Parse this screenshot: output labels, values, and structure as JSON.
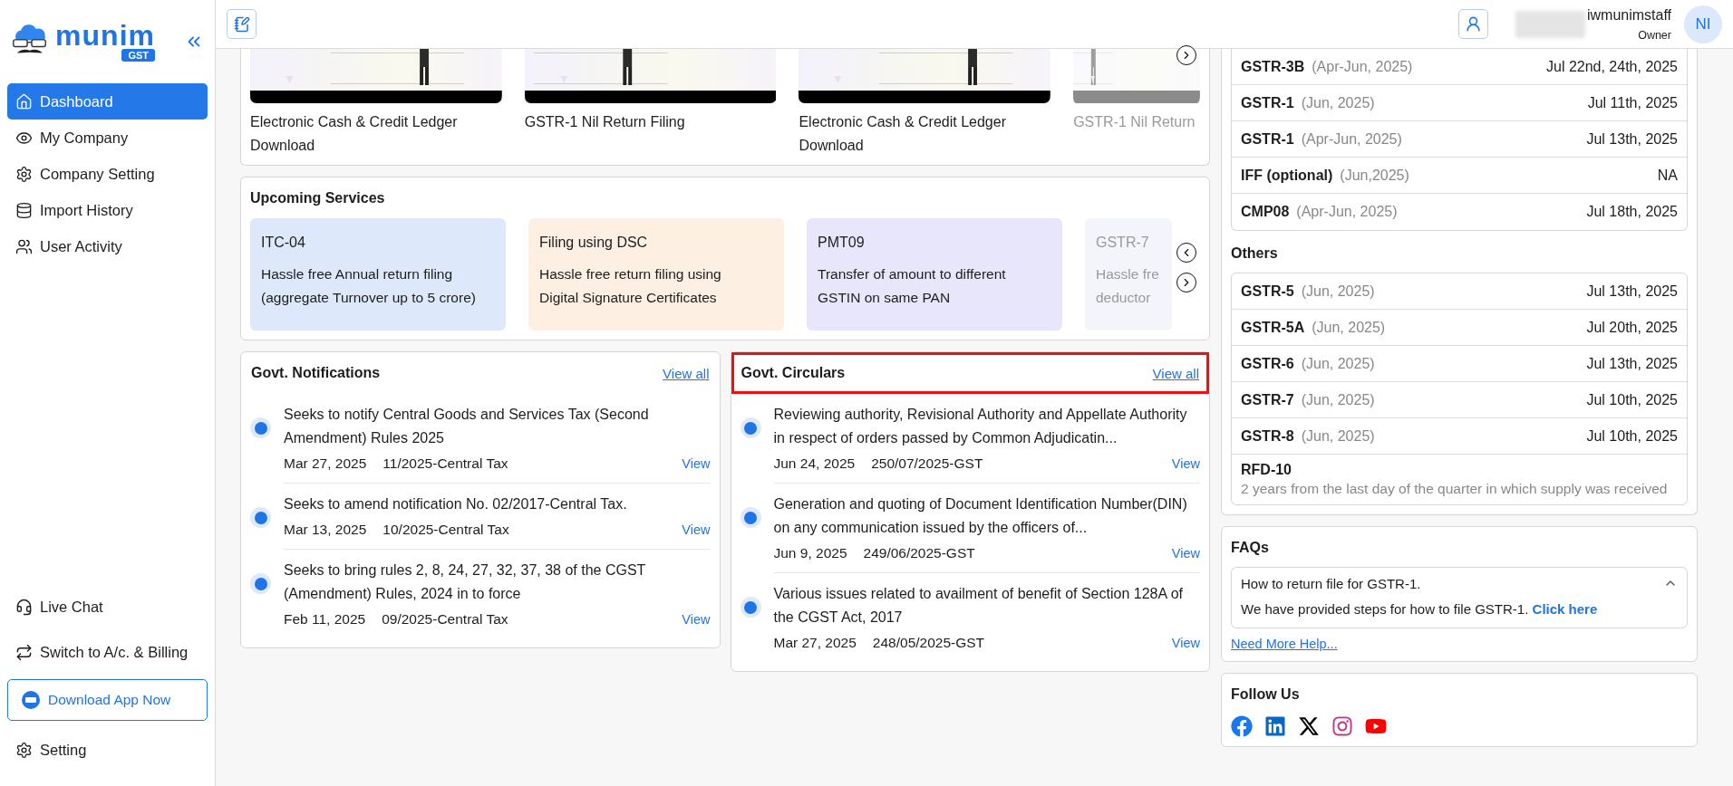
{
  "sidebar": {
    "logo": {
      "name": "munim",
      "badge": "GST"
    },
    "items": [
      {
        "label": "Dashboard",
        "selected": true
      },
      {
        "label": "My Company",
        "selected": false
      },
      {
        "label": "Company Setting",
        "selected": false
      },
      {
        "label": "Import History",
        "selected": false
      },
      {
        "label": "User Activity",
        "selected": false
      }
    ],
    "bottom_items": [
      {
        "label": "Live Chat"
      },
      {
        "label": "Switch to A/c. & Billing"
      }
    ],
    "download_button": "Download App Now",
    "setting": "Setting"
  },
  "header": {
    "user_name": "iwmunimstaff",
    "role": "Owner",
    "avatar_initials": "NI"
  },
  "videos": [
    {
      "title": "Electronic Cash & Credit Ledger Download",
      "faded": false
    },
    {
      "title": "GSTR-1 Nil Return Filing",
      "faded": false
    },
    {
      "title": "Electronic Cash & Credit Ledger Download",
      "faded": false
    },
    {
      "title": "GSTR-1 Nil Return",
      "faded": true
    }
  ],
  "upcoming_services": {
    "title": "Upcoming Services",
    "items": [
      {
        "title": "ITC-04",
        "description": "Hassle free Annual return filing\n(aggregate Turnover up to 5 crore)",
        "color": "#dde9fb",
        "faded": false
      },
      {
        "title": "Filing using DSC",
        "description": "Hassle free return filing using\nDigital Signature Certificates",
        "color": "#fdefe2",
        "faded": false
      },
      {
        "title": "PMT09",
        "description": "Transfer of amount to different\nGSTIN on same PAN",
        "color": "#e8e6fb",
        "faded": false
      },
      {
        "title": "GSTR-7",
        "description": "Hassle fre\ndeductor",
        "color": "#f4f4fb",
        "faded": true
      }
    ]
  },
  "notifications": {
    "title": "Govt. Notifications",
    "view_all": "View all",
    "highlighted": false,
    "items": [
      {
        "text": "Seeks to notify Central Goods and Services Tax (Second Amendment) Rules 2025",
        "date": "Mar 27, 2025",
        "number": "11/2025-Central Tax",
        "action": "View"
      },
      {
        "text": "Seeks to amend notification No. 02/2017-Central Tax.",
        "date": "Mar 13, 2025",
        "number": "10/2025-Central Tax",
        "action": "View"
      },
      {
        "text": "Seeks to bring rules 2, 8, 24, 27, 32, 37, 38 of the CGST (Amendment) Rules, 2024 in to force",
        "date": "Feb 11, 2025",
        "number": "09/2025-Central Tax",
        "action": "View"
      }
    ]
  },
  "circulars": {
    "title": "Govt. Circulars",
    "view_all": "View all",
    "highlighted": true,
    "items": [
      {
        "text": "Reviewing authority, Revisional Authority and Appellate Authority in respect of orders passed by Common Adjudicatin...",
        "date": "Jun 24, 2025",
        "number": "250/07/2025-GST",
        "action": "View"
      },
      {
        "text": "Generation and quoting of Document Identification Number(DIN) on any communication issued by the officers of...",
        "date": "Jun 9, 2025",
        "number": "249/06/2025-GST",
        "action": "View"
      },
      {
        "text": "Various issues related to availment of benefit of Section 128A of the CGST Act, 2017",
        "date": "Mar 27, 2025",
        "number": "248/05/2025-GST",
        "action": "View"
      }
    ]
  },
  "due_dates": {
    "rows": [
      {
        "form": "GSTR-3B",
        "period": "(Apr-Jun, 2025)",
        "date": "Jul 22nd, 24th, 2025"
      },
      {
        "form": "GSTR-1",
        "period": "(Jun, 2025)",
        "date": "Jul 11th, 2025"
      },
      {
        "form": "GSTR-1",
        "period": "(Apr-Jun, 2025)",
        "date": "Jul 13th, 2025"
      },
      {
        "form": "IFF (optional)",
        "period": "(Jun,2025)",
        "date": "NA"
      },
      {
        "form": "CMP08",
        "period": "(Apr-Jun, 2025)",
        "date": "Jul 18th, 2025"
      }
    ],
    "others_title": "Others",
    "others": [
      {
        "form": "GSTR-5",
        "period": "(Jun, 2025)",
        "date": "Jul 13th, 2025"
      },
      {
        "form": "GSTR-5A",
        "period": "(Jun, 2025)",
        "date": "Jul 20th, 2025"
      },
      {
        "form": "GSTR-6",
        "period": "(Jun, 2025)",
        "date": "Jul 13th, 2025"
      },
      {
        "form": "GSTR-7",
        "period": "(Jun, 2025)",
        "date": "Jul 10th, 2025"
      },
      {
        "form": "GSTR-8",
        "period": "(Jun, 2025)",
        "date": "Jul 10th, 2025"
      }
    ],
    "note": {
      "form": "RFD-10",
      "description": "2 years from the last day of the quarter in which supply was received"
    }
  },
  "faqs": {
    "title": "FAQs",
    "items": [
      {
        "question": "How to return file for GSTR-1.",
        "answer": "We have provided steps for how to file GSTR-1.",
        "link": "Click here",
        "expanded": true
      }
    ],
    "help_link": "Need More Help..."
  },
  "follow_us": {
    "title": "Follow Us"
  }
}
